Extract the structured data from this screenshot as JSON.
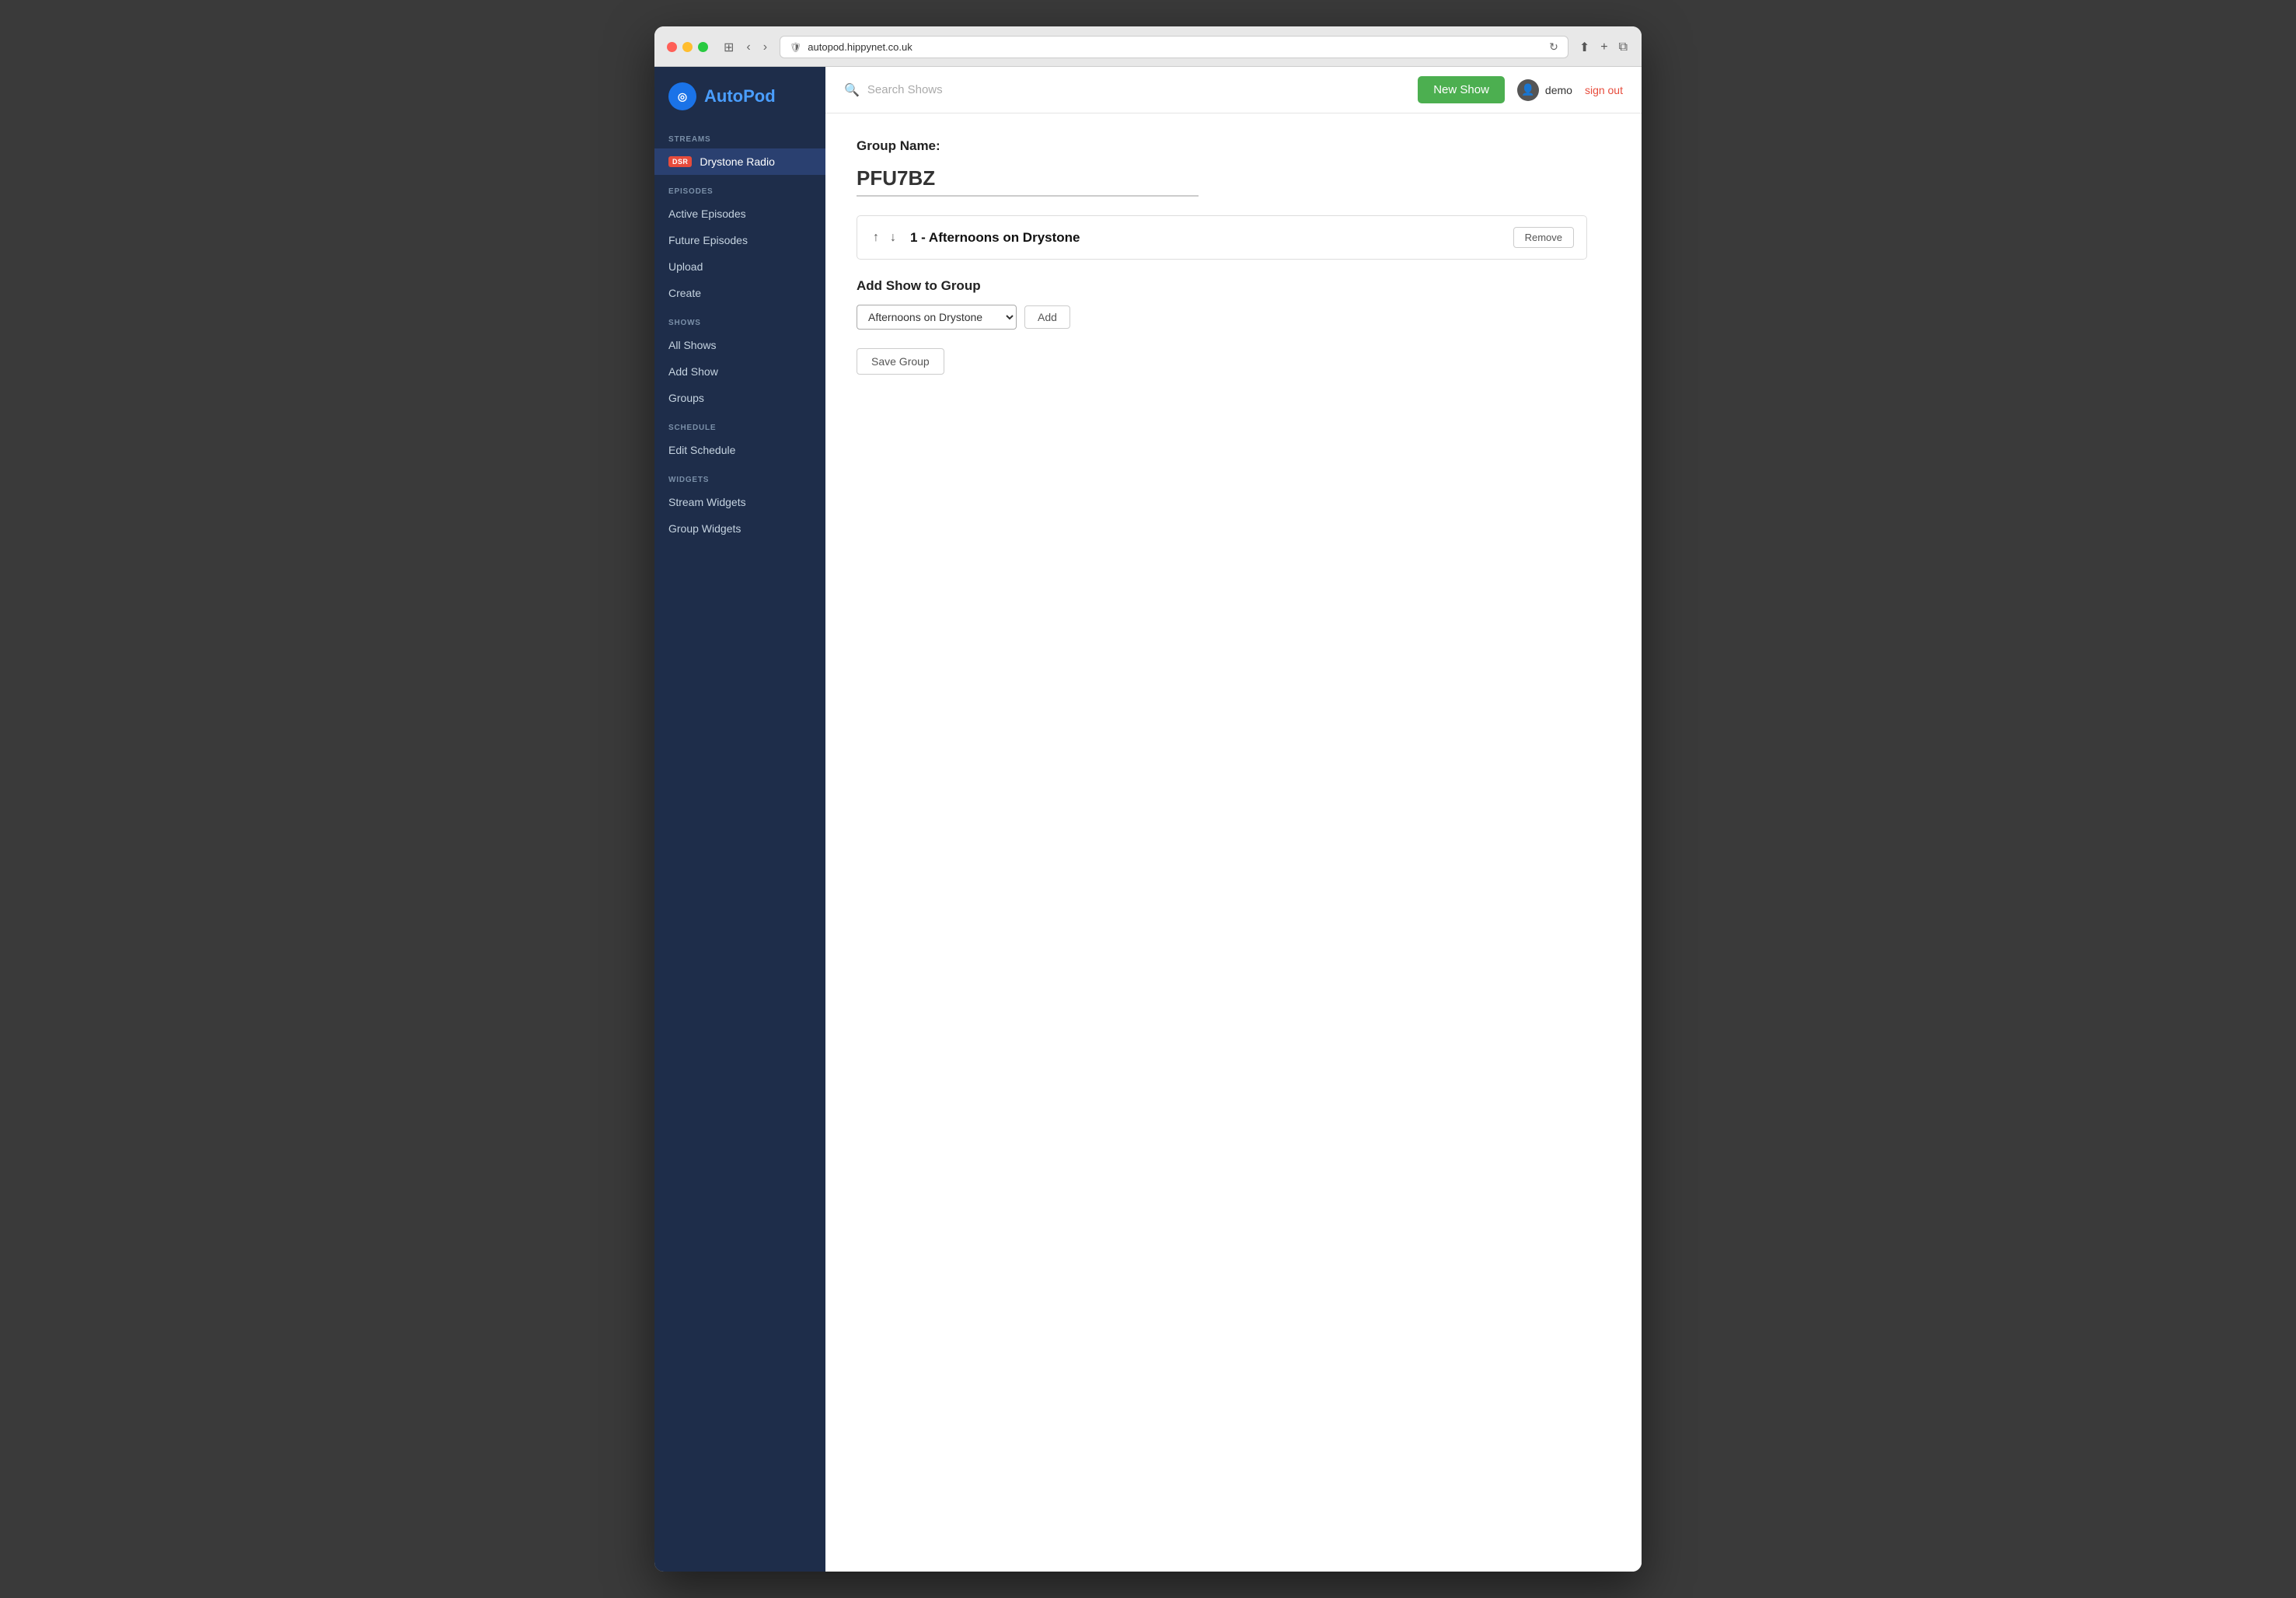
{
  "browser": {
    "url": "autopod.hippynet.co.uk",
    "security_icon": "🔒"
  },
  "header": {
    "search_placeholder": "Search Shows",
    "new_show_label": "New Show",
    "user_name": "demo",
    "sign_out_label": "sign out"
  },
  "sidebar": {
    "logo_text_auto": "Auto",
    "logo_text_pod": "Pod",
    "logo_icon": "◎",
    "sections": [
      {
        "label": "STREAMS",
        "items": [
          {
            "id": "drystone-radio",
            "label": "Drystone Radio",
            "badge": "DSR",
            "active": true
          }
        ]
      },
      {
        "label": "EPISODES",
        "items": [
          {
            "id": "active-episodes",
            "label": "Active Episodes",
            "active": false
          },
          {
            "id": "future-episodes",
            "label": "Future Episodes",
            "active": false
          },
          {
            "id": "upload",
            "label": "Upload",
            "active": false
          },
          {
            "id": "create",
            "label": "Create",
            "active": false
          }
        ]
      },
      {
        "label": "SHOWS",
        "items": [
          {
            "id": "all-shows",
            "label": "All Shows",
            "active": false
          },
          {
            "id": "add-show",
            "label": "Add Show",
            "active": false
          },
          {
            "id": "groups",
            "label": "Groups",
            "active": false
          }
        ]
      },
      {
        "label": "SCHEDULE",
        "items": [
          {
            "id": "edit-schedule",
            "label": "Edit Schedule",
            "active": false
          }
        ]
      },
      {
        "label": "WIDGETS",
        "items": [
          {
            "id": "stream-widgets",
            "label": "Stream Widgets",
            "active": false
          },
          {
            "id": "group-widgets",
            "label": "Group Widgets",
            "active": false
          }
        ]
      }
    ]
  },
  "main": {
    "group_name_label": "Group Name:",
    "group_name_value": "PFU7BZ",
    "show_row": {
      "number": "1",
      "title": "Afternoons on Drystone"
    },
    "show_row_display": "1 - Afternoons on Drystone",
    "remove_btn": "Remove",
    "add_show_section_label": "Add Show to Group",
    "add_show_select_value": "Afternoons on Drystone",
    "add_btn_label": "Add",
    "save_btn_label": "Save Group",
    "select_options": [
      "Afternoons on Drystone"
    ]
  }
}
